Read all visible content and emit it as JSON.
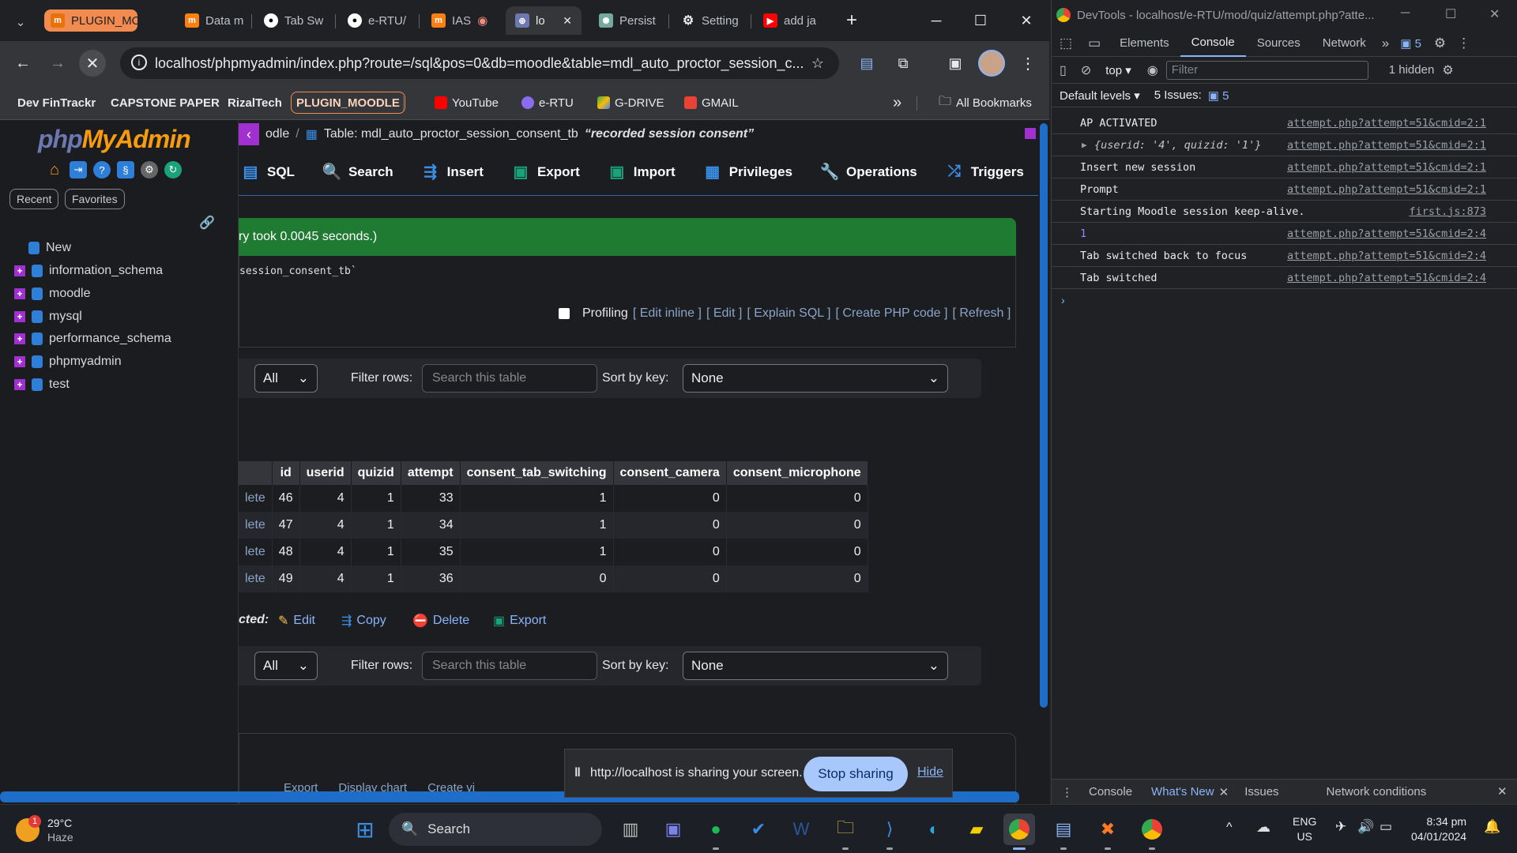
{
  "browser": {
    "tabs": [
      {
        "label": "PLUGIN_MOODLE",
        "icon": "tab-group-label"
      },
      {
        "label": "Data m",
        "icon": "moodle-icon"
      },
      {
        "label": "Tab Sw",
        "icon": "github-icon"
      },
      {
        "label": "e-RTU/",
        "icon": "github-icon"
      },
      {
        "label": "IAS",
        "icon": "moodle-icon"
      },
      {
        "label": "lo",
        "icon": "pma-icon"
      },
      {
        "label": "Persist",
        "icon": "chatgpt-icon"
      },
      {
        "label": "Setting",
        "icon": "gear-icon"
      },
      {
        "label": "add ja",
        "icon": "youtube-icon"
      }
    ],
    "url": "localhost/phpmyadmin/index.php?route=/sql&pos=0&db=moodle&table=mdl_auto_proctor_session_c...",
    "bookmarks": [
      "Dev FinTrackr",
      "CAPSTONE PAPER",
      "RizalTech",
      "PLUGIN_MOODLE",
      "YouTube",
      "e-RTU",
      "G-DRIVE",
      "GMAIL"
    ],
    "all_bookmarks": "All Bookmarks",
    "more_bookmarks": "»"
  },
  "pma": {
    "logo_a": "php",
    "logo_b": "MyAdmin",
    "recent": "Recent",
    "favorites": "Favorites",
    "databases": [
      "New",
      "information_schema",
      "moodle",
      "mysql",
      "performance_schema",
      "phpmyadmin",
      "test"
    ],
    "breadcrumb_db": "odle",
    "breadcrumb_sep": "/",
    "breadcrumb_table": "Table: mdl_auto_proctor_session_consent_tb",
    "breadcrumb_comment": "“recorded session consent”",
    "menu": [
      "SQL",
      "Search",
      "Insert",
      "Export",
      "Import",
      "Privileges",
      "Operations",
      "Triggers"
    ],
    "success_text": "ry took 0.0045 seconds.)",
    "sql_text": "session_consent_tb`",
    "profiling": "Profiling",
    "sql_links": [
      "[ Edit inline ]",
      "[ Edit ]",
      "[ Explain SQL ]",
      "[ Create PHP code ]",
      "[ Refresh ]"
    ],
    "filter": {
      "show_value": "All",
      "filter_label": "Filter rows:",
      "placeholder": "Search this table",
      "sort_label": "Sort by key:",
      "sort_value": "None"
    },
    "table": {
      "columns": [
        "id",
        "userid",
        "quizid",
        "attempt",
        "consent_tab_switching",
        "consent_camera",
        "consent_microphone"
      ],
      "rows": [
        {
          "action": "lete",
          "cells": [
            "46",
            "4",
            "1",
            "33",
            "1",
            "0",
            "0"
          ]
        },
        {
          "action": "lete",
          "cells": [
            "47",
            "4",
            "1",
            "34",
            "1",
            "0",
            "0"
          ]
        },
        {
          "action": "lete",
          "cells": [
            "48",
            "4",
            "1",
            "35",
            "1",
            "0",
            "0"
          ]
        },
        {
          "action": "lete",
          "cells": [
            "49",
            "4",
            "1",
            "36",
            "0",
            "0",
            "0"
          ]
        }
      ]
    },
    "with_selected": "cted:",
    "bulk": [
      "Edit",
      "Copy",
      "Delete",
      "Export"
    ],
    "bottom_ops": [
      "Export",
      "Display chart",
      "Create vi"
    ]
  },
  "share": {
    "text": "http://localhost is sharing your screen.",
    "stop": "Stop sharing",
    "hide": "Hide"
  },
  "devtools": {
    "title": "DevTools - localhost/e-RTU/mod/quiz/attempt.php?atte...",
    "tabs": [
      "Elements",
      "Console",
      "Sources",
      "Network"
    ],
    "issues_badge": "5",
    "context": "top",
    "filter_placeholder": "Filter",
    "hidden": "1 hidden",
    "levels": "Default levels",
    "issues_label": "5 Issues:",
    "issues_count": "5",
    "logs": [
      {
        "msg": "AP ACTIVATED",
        "src": "attempt.php?attempt=51&cmid=2:1"
      },
      {
        "msg": "{userid: '4', quizid: '1'}",
        "src": "attempt.php?attempt=51&cmid=2:1",
        "object": true
      },
      {
        "msg": "Insert new session",
        "src": "attempt.php?attempt=51&cmid=2:1"
      },
      {
        "msg": "Prompt",
        "src": "attempt.php?attempt=51&cmid=2:1"
      },
      {
        "msg": "Starting Moodle session keep-alive.",
        "src": "first.js:873"
      },
      {
        "msg": "1",
        "src": "attempt.php?attempt=51&cmid=2:4",
        "number": true
      },
      {
        "msg": "Tab switched back to focus",
        "src": "attempt.php?attempt=51&cmid=2:4"
      },
      {
        "msg": "Tab switched",
        "src": "attempt.php?attempt=51&cmid=2:4"
      }
    ],
    "drawer_tabs": [
      "Console",
      "What's New",
      "Issues",
      "Network conditions"
    ]
  },
  "taskbar": {
    "weather_temp": "29°C",
    "weather_desc": "Haze",
    "weather_badge": "1",
    "search": "Search",
    "lang1": "ENG",
    "lang2": "US",
    "time": "8:34 pm",
    "date": "04/01/2024"
  }
}
